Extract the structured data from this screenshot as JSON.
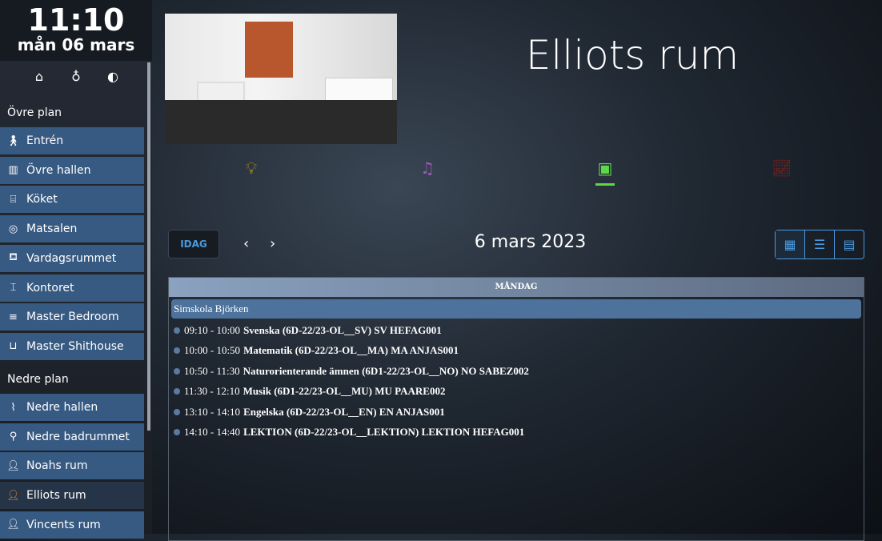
{
  "clock": {
    "time": "11:10",
    "date": "mån 06 mars"
  },
  "top_icons": [
    "house-icon",
    "lightbulb-icon",
    "zwave-icon"
  ],
  "sidebar": {
    "sections": [
      {
        "label": "Övre plan",
        "items": [
          {
            "label": "Entrén",
            "icon": "door-walk-icon"
          },
          {
            "label": "Övre hallen",
            "icon": "hall-icon"
          },
          {
            "label": "Köket",
            "icon": "kitchen-icon"
          },
          {
            "label": "Matsalen",
            "icon": "dining-icon"
          },
          {
            "label": "Vardagsrummet",
            "icon": "sofa-icon"
          },
          {
            "label": "Kontoret",
            "icon": "desk-icon"
          },
          {
            "label": "Master Bedroom",
            "icon": "bed-icon"
          },
          {
            "label": "Master Shithouse",
            "icon": "bathtub-icon"
          }
        ]
      },
      {
        "label": "Nedre plan",
        "items": [
          {
            "label": "Nedre hallen",
            "icon": "stairs-icon"
          },
          {
            "label": "Nedre badrummet",
            "icon": "shower-icon"
          },
          {
            "label": "Noahs rum",
            "icon": "person-icon"
          },
          {
            "label": "Elliots rum",
            "icon": "person-icon",
            "selected": true
          },
          {
            "label": "Vincents rum",
            "icon": "person-icon"
          }
        ]
      }
    ]
  },
  "room": {
    "title": "Elliots rum"
  },
  "tabs": [
    {
      "icon": "lightbulb-icon",
      "color": "#c8961e"
    },
    {
      "icon": "music-icon",
      "color": "#9b59b6"
    },
    {
      "icon": "calendar-icon",
      "color": "#5fd847",
      "active": true
    },
    {
      "icon": "energy-chart-icon",
      "color": "#7a2020"
    }
  ],
  "calendar": {
    "today_label": "IDAG",
    "date_label": "6 mars 2023",
    "day_header": "MÅNDAG",
    "all_day": "Simskola Björken",
    "events": [
      {
        "time": "09:10 - 10:00",
        "title": "Svenska (6D-22/23-OL__SV) SV HEFAG001"
      },
      {
        "time": "10:00 - 10:50",
        "title": "Matematik (6D-22/23-OL__MA) MA ANJAS001"
      },
      {
        "time": "10:50 - 11:30",
        "title": "Naturorienterande ämnen (6D1-22/23-OL__NO) NO SABEZ002"
      },
      {
        "time": "11:30 - 12:10",
        "title": "Musik (6D1-22/23-OL__MU) MU PAARE002"
      },
      {
        "time": "13:10 - 14:10",
        "title": "Engelska (6D-22/23-OL__EN) EN ANJAS001"
      },
      {
        "time": "14:10 - 14:40",
        "title": "LEKTION (6D-22/23-OL__LEKTION) LEKTION HEFAG001"
      }
    ]
  }
}
